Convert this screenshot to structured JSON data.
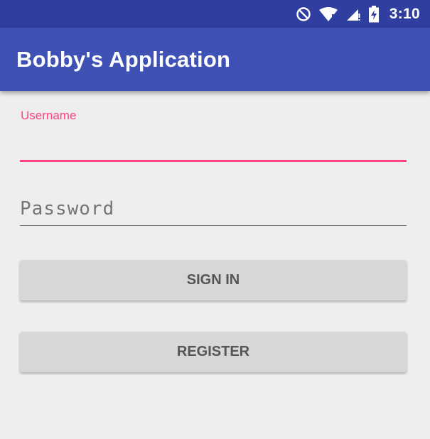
{
  "status_bar": {
    "icons": [
      "do-not-disturb-icon",
      "wifi-icon",
      "cell-signal-icon",
      "battery-charging-icon"
    ],
    "time": "3:10"
  },
  "app_bar": {
    "title": "Bobby's Application"
  },
  "form": {
    "username_label": "Username",
    "username_value": "",
    "password_placeholder": "Password",
    "password_value": ""
  },
  "buttons": {
    "sign_in": "SIGN IN",
    "register": "REGISTER"
  },
  "colors": {
    "status_bar": "#303f9f",
    "app_bar": "#3f51b5",
    "accent": "#ff4081",
    "background": "#eeeeee",
    "button": "#d6d7d7"
  }
}
